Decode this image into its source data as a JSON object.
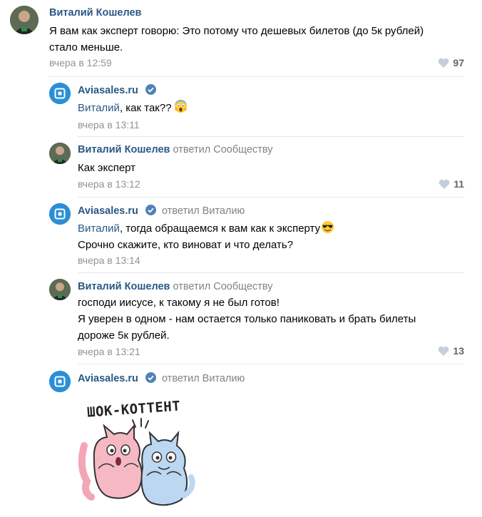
{
  "comments": [
    {
      "author": "Виталий Кошелев",
      "replied_to": "",
      "text_lines": [
        "Я вам как эксперт говорю: Это потому что дешевых билетов (до 5к рублей)",
        "стало меньше."
      ],
      "time": "вчера в 12:59",
      "likes": "97",
      "avatar": "user-photo"
    },
    {
      "author": "Aviasales.ru",
      "replied_to": "",
      "mention": "Виталий",
      "text_lines": [
        ", как так??"
      ],
      "emoji": "screaming-face",
      "time": "вчера в 13:11",
      "likes": "",
      "avatar": "aviasales-logo"
    },
    {
      "author": "Виталий Кошелев",
      "replied_to": "ответил Сообществу",
      "text_lines": [
        "Как эксперт"
      ],
      "time": "вчера в 13:12",
      "likes": "11",
      "avatar": "user-photo"
    },
    {
      "author": "Aviasales.ru",
      "replied_to": "ответил Виталию",
      "mention": "Виталий",
      "text_lines": [
        ", тогда обращаемся к вам как к эксперту",
        "Срочно скажите, кто виноват и что делать?"
      ],
      "emoji": "sunglasses-face",
      "time": "вчера в 13:14",
      "likes": "",
      "avatar": "aviasales-logo"
    },
    {
      "author": "Виталий Кошелев",
      "replied_to": "ответил Сообществу",
      "text_lines": [
        "господи иисусе, к такому я не был готов!",
        "Я уверен в одном - нам остается только паниковать и брать билеты",
        "дороже 5к рублей."
      ],
      "time": "вчера в 13:21",
      "likes": "13",
      "avatar": "user-photo"
    },
    {
      "author": "Aviasales.ru",
      "replied_to": "ответил Виталию",
      "sticker_caption": "ШОК-КОТТЕНТ",
      "sticker": "shocked-cats-sticker",
      "avatar": "aviasales-logo"
    }
  ],
  "colors": {
    "link": "#2a5885",
    "muted": "#939393",
    "verified": "#5181b8",
    "aviasales_blue": "#2a8fd6",
    "divider": "#e7e8ec"
  }
}
